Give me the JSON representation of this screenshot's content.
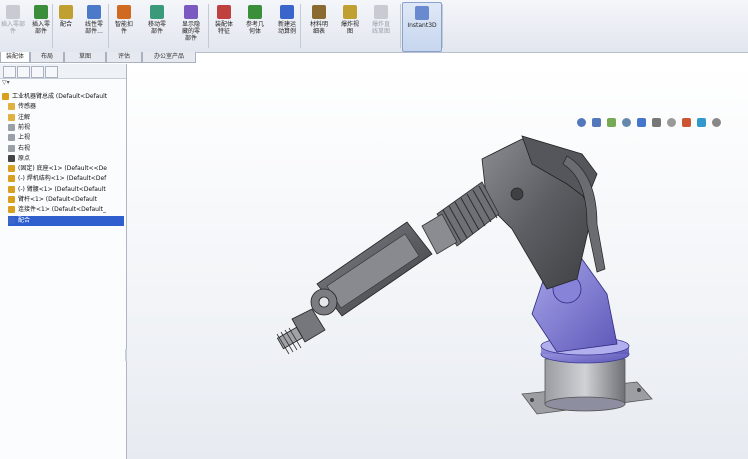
{
  "toolbar": {
    "buttons": [
      {
        "label": "插入零部件",
        "icon": "insert-component-icon",
        "disabled": true
      },
      {
        "label": "插入零\n部件",
        "icon": "insert-parts-icon",
        "disabled": false
      },
      {
        "label": "配合",
        "icon": "mate-icon",
        "disabled": false
      },
      {
        "label": "线性零\n部件...",
        "icon": "linear-pattern-icon",
        "disabled": false
      },
      {
        "label": "智能扣\n件",
        "icon": "smart-fasteners-icon",
        "disabled": false
      },
      {
        "label": "移动零\n部件",
        "icon": "move-component-icon",
        "disabled": false
      },
      {
        "label": "显示隐\n藏的零\n部件",
        "icon": "show-hidden-icon",
        "disabled": false
      },
      {
        "label": "装配体\n特征",
        "icon": "assembly-feature-icon",
        "disabled": false
      },
      {
        "label": "参考几\n何体",
        "icon": "reference-geometry-icon",
        "disabled": false
      },
      {
        "label": "新建运\n动算例",
        "icon": "new-motion-study-icon",
        "disabled": false
      },
      {
        "label": "材料明\n细表",
        "icon": "bom-icon",
        "disabled": false
      },
      {
        "label": "爆炸视\n图",
        "icon": "exploded-view-icon",
        "disabled": false
      },
      {
        "label": "爆炸直\n线草图",
        "icon": "explode-line-sketch-icon",
        "disabled": true
      },
      {
        "label": "Instant3D",
        "icon": "instant3d-icon",
        "disabled": false
      }
    ]
  },
  "tabs": [
    {
      "label": "装配体",
      "selected": true
    },
    {
      "label": "布局",
      "selected": false
    },
    {
      "label": "草图",
      "selected": false
    },
    {
      "label": "评估",
      "selected": false
    },
    {
      "label": "办公室产品",
      "selected": false
    }
  ],
  "pane": {
    "filter": "▽▾",
    "tree": [
      {
        "label": "工业机器臂总成 (Default<Default",
        "icon": "assembly-icon",
        "indent": 0,
        "color": "#d9a020"
      },
      {
        "label": "传感器",
        "icon": "folder-icon",
        "indent": 1,
        "color": "#e0b040"
      },
      {
        "label": "注解",
        "icon": "annotation-icon",
        "indent": 1,
        "color": "#e0b040"
      },
      {
        "label": "前视",
        "icon": "plane-icon",
        "indent": 1,
        "color": "#9aa0a8"
      },
      {
        "label": "上视",
        "icon": "plane-icon",
        "indent": 1,
        "color": "#9aa0a8"
      },
      {
        "label": "右视",
        "icon": "plane-icon",
        "indent": 1,
        "color": "#9aa0a8"
      },
      {
        "label": "原点",
        "icon": "origin-icon",
        "indent": 1,
        "color": "#444444"
      },
      {
        "label": "(固定) 底座<1> (Default<<De",
        "icon": "part-icon",
        "indent": 1,
        "color": "#d9a020"
      },
      {
        "label": "(-) 焊机结构<1> (Default<Def",
        "icon": "part-icon",
        "indent": 1,
        "color": "#d9a020"
      },
      {
        "label": "(-) 臂腰<1> (Default<Default",
        "icon": "part-icon",
        "indent": 1,
        "color": "#d9a020"
      },
      {
        "label": "臂杆<1> (Default<Default",
        "icon": "part-icon",
        "indent": 1,
        "color": "#d9a020"
      },
      {
        "label": "连接件<1> (Default<Default_",
        "icon": "part-icon",
        "indent": 1,
        "color": "#d9a020"
      },
      {
        "label": "配合",
        "icon": "mates-icon",
        "indent": 1,
        "color": "#3a66cc",
        "selected": true
      }
    ]
  },
  "viewport": {
    "background_top": "#ffffff",
    "background_bottom": "#e7ebf1",
    "view_tools": [
      "zoom-to-fit-icon",
      "zoom-area-icon",
      "previous-view-icon",
      "section-view-icon",
      "view-orientation-icon",
      "display-style-icon",
      "hide-show-icon",
      "edit-appearance-icon",
      "scene-icon",
      "view-settings-icon"
    ],
    "model": {
      "body_color": "#6b6d72",
      "accent_color": "#8a87d9"
    }
  }
}
